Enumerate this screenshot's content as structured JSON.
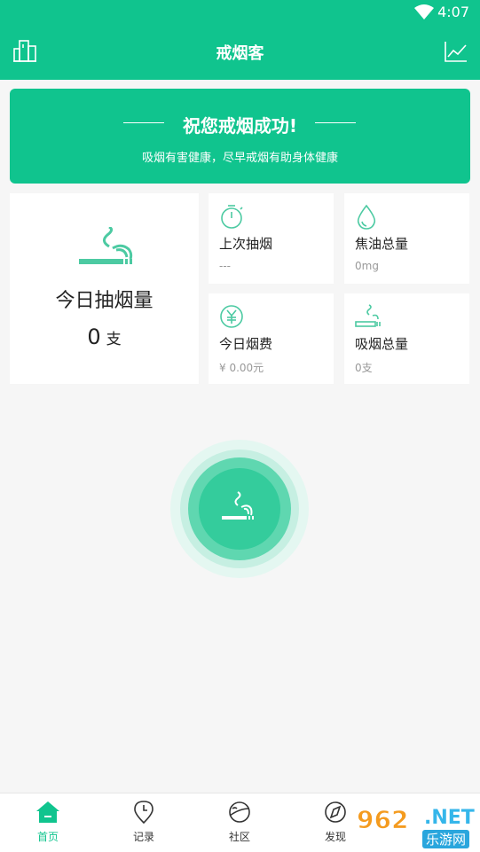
{
  "status_bar": {
    "time": "4:07"
  },
  "header": {
    "title": "戒烟客",
    "left_icon": "buildings-icon",
    "right_icon": "trend-chart-icon"
  },
  "banner": {
    "headline": "祝您戒烟成功!",
    "subtitle": "吸烟有害健康，尽早戒烟有助身体健康"
  },
  "today_card": {
    "label": "今日抽烟量",
    "value": "0",
    "unit": "支"
  },
  "stats": [
    {
      "icon": "stopwatch-icon",
      "label": "上次抽烟",
      "value": "---"
    },
    {
      "icon": "droplet-icon",
      "label": "焦油总量",
      "value": "0mg"
    },
    {
      "icon": "yen-icon",
      "label": "今日烟费",
      "value": "¥ 0.00元"
    },
    {
      "icon": "cigarette-icon",
      "label": "吸烟总量",
      "value": "0支"
    }
  ],
  "colors": {
    "accent": "#10c48e",
    "muted": "#999999"
  },
  "tabs": [
    {
      "label": "首页",
      "icon": "home-icon",
      "active": true
    },
    {
      "label": "记录",
      "icon": "location-pin-icon"
    },
    {
      "label": "社区",
      "icon": "planet-icon"
    },
    {
      "label": "发现",
      "icon": "compass-icon"
    }
  ],
  "watermark": {
    "num": "962",
    "net": ".NET",
    "sub": "乐游网"
  }
}
